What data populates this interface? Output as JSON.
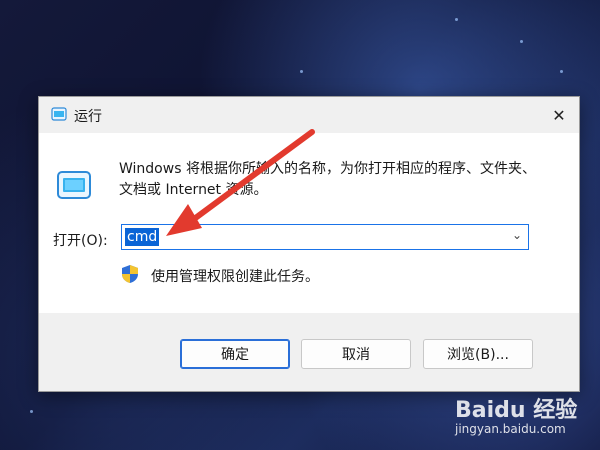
{
  "dialog": {
    "title": "运行",
    "close_glyph": "✕",
    "description": "Windows 将根据你所输入的名称，为你打开相应的程序、文件夹、文档或 Internet 资源。",
    "open_label": "打开(O):",
    "open_value": "cmd",
    "dropdown_glyph": "⌄",
    "admin_note": "使用管理权限创建此任务。",
    "buttons": {
      "ok": "确定",
      "cancel": "取消",
      "browse": "浏览(B)..."
    }
  },
  "watermark": {
    "brand": "Baidu 经验",
    "url": "jingyan.baidu.com"
  },
  "colors": {
    "selection": "#0a64d6",
    "arrow": "#e23a2e",
    "focus_border": "#1a73e8"
  },
  "icons": [
    "run-icon",
    "shield-icon",
    "close-icon",
    "chevron-down-icon"
  ]
}
